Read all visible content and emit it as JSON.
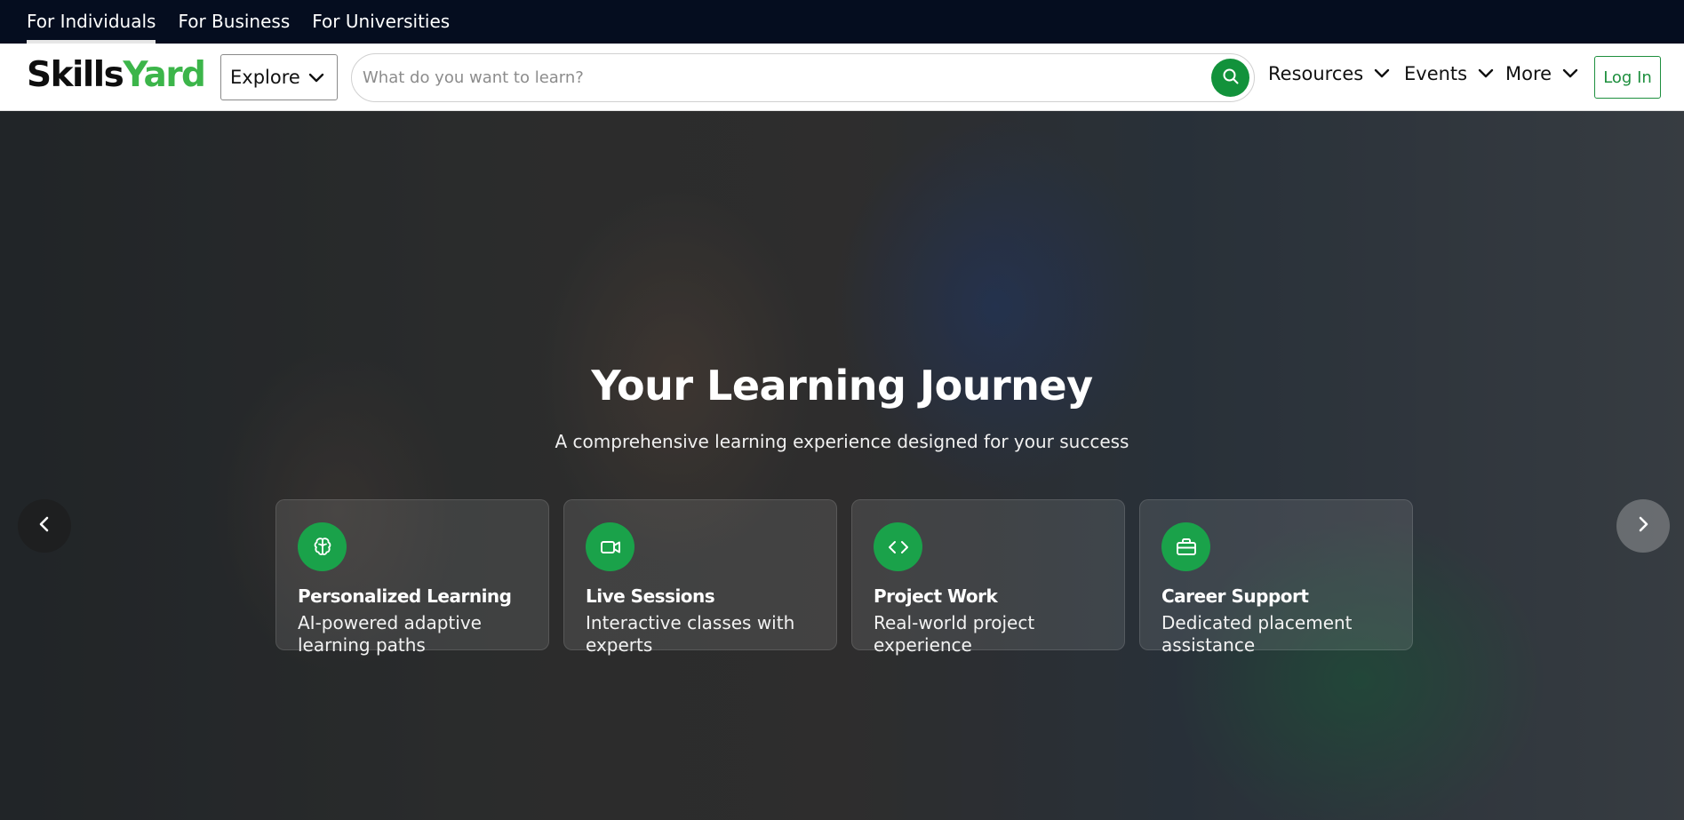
{
  "audience_tabs": [
    {
      "label": "For Individuals",
      "active": true
    },
    {
      "label": "For Business",
      "active": false
    },
    {
      "label": "For Universities",
      "active": false
    }
  ],
  "brand": {
    "logo_part1": "Skills",
    "logo_part2": "Yard",
    "accent_color": "#3cb54a",
    "primary_green": "#12923b"
  },
  "nav": {
    "explore_label": "Explore",
    "search_placeholder": "What do you want to learn?",
    "search_value": "",
    "menus": [
      {
        "label": "Resources"
      },
      {
        "label": "Events"
      },
      {
        "label": "More"
      }
    ],
    "login_label": "Log In"
  },
  "hero": {
    "title": "Your Learning Journey",
    "subtitle": "A comprehensive learning experience designed for your success",
    "cards": [
      {
        "icon": "brain-icon",
        "title": "Personalized Learning",
        "desc": "AI-powered adaptive learning paths"
      },
      {
        "icon": "video-icon",
        "title": "Live Sessions",
        "desc": "Interactive classes with experts"
      },
      {
        "icon": "code-icon",
        "title": "Project Work",
        "desc": "Real-world project experience"
      },
      {
        "icon": "briefcase-icon",
        "title": "Career Support",
        "desc": "Dedicated placement assistance"
      }
    ]
  }
}
